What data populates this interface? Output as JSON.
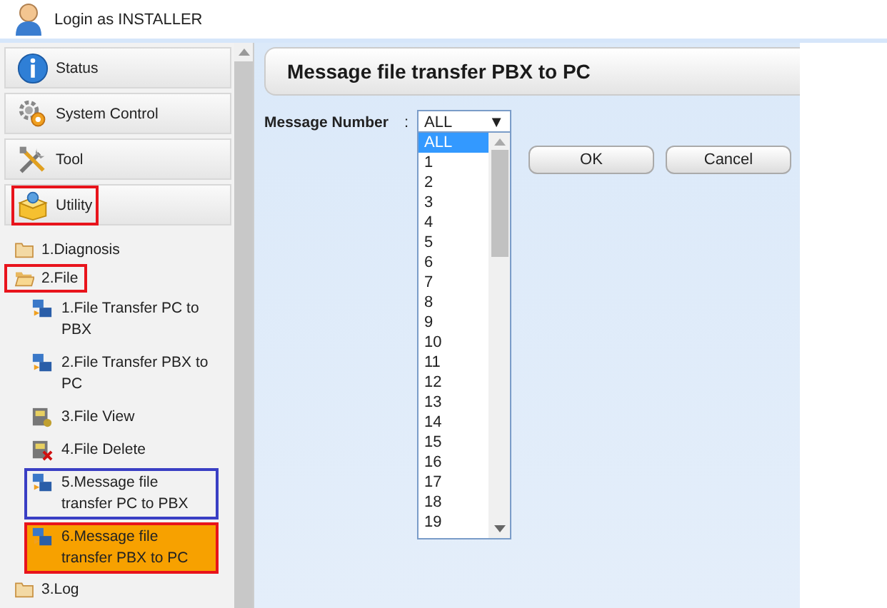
{
  "header": {
    "login_text": "Login as INSTALLER"
  },
  "nav": [
    {
      "label": "Status"
    },
    {
      "label": "System Control"
    },
    {
      "label": "Tool"
    },
    {
      "label": "Utility",
      "color": "#e8141c"
    }
  ],
  "tree": [
    {
      "label": "1.Diagnosis",
      "expanded": false
    },
    {
      "label": "2.File",
      "expanded": true,
      "color": "#e8141c",
      "children": [
        {
          "label": "1.File Transfer PC to PBX",
          "kind": "transfer",
          "selected": false
        },
        {
          "label": "2.File Transfer PBX to PC",
          "kind": "transfer",
          "selected": false
        },
        {
          "label": "3.File View",
          "kind": "view",
          "selected": false
        },
        {
          "label": "4.File Delete",
          "kind": "delete",
          "selected": false
        },
        {
          "label": "5.Message file transfer PC to PBX",
          "kind": "transfer",
          "selected": false,
          "color": "#3a3fc4"
        },
        {
          "label": "6.Message file transfer PBX to PC",
          "kind": "transfer",
          "selected": true,
          "color": "#e8141c"
        }
      ]
    },
    {
      "label": "3.Log",
      "expanded": false
    }
  ],
  "main": {
    "title": "Message file transfer PBX to PC",
    "field_label": "Message Number",
    "colon": ":",
    "select_value": "ALL",
    "select_arrow": "▼",
    "options": [
      {
        "label": "ALL",
        "selected": true
      },
      {
        "label": "1",
        "selected": false
      },
      {
        "label": "2",
        "selected": false
      },
      {
        "label": "3",
        "selected": false
      },
      {
        "label": "4",
        "selected": false
      },
      {
        "label": "5",
        "selected": false
      },
      {
        "label": "6",
        "selected": false
      },
      {
        "label": "7",
        "selected": false
      },
      {
        "label": "8",
        "selected": false
      },
      {
        "label": "9",
        "selected": false
      },
      {
        "label": "10",
        "selected": false
      },
      {
        "label": "11",
        "selected": false
      },
      {
        "label": "12",
        "selected": false
      },
      {
        "label": "13",
        "selected": false
      },
      {
        "label": "14",
        "selected": false
      },
      {
        "label": "15",
        "selected": false
      },
      {
        "label": "16",
        "selected": false
      },
      {
        "label": "17",
        "selected": false
      },
      {
        "label": "18",
        "selected": false
      },
      {
        "label": "19",
        "selected": false
      }
    ],
    "buttons": [
      "OK",
      "Cancel"
    ]
  }
}
